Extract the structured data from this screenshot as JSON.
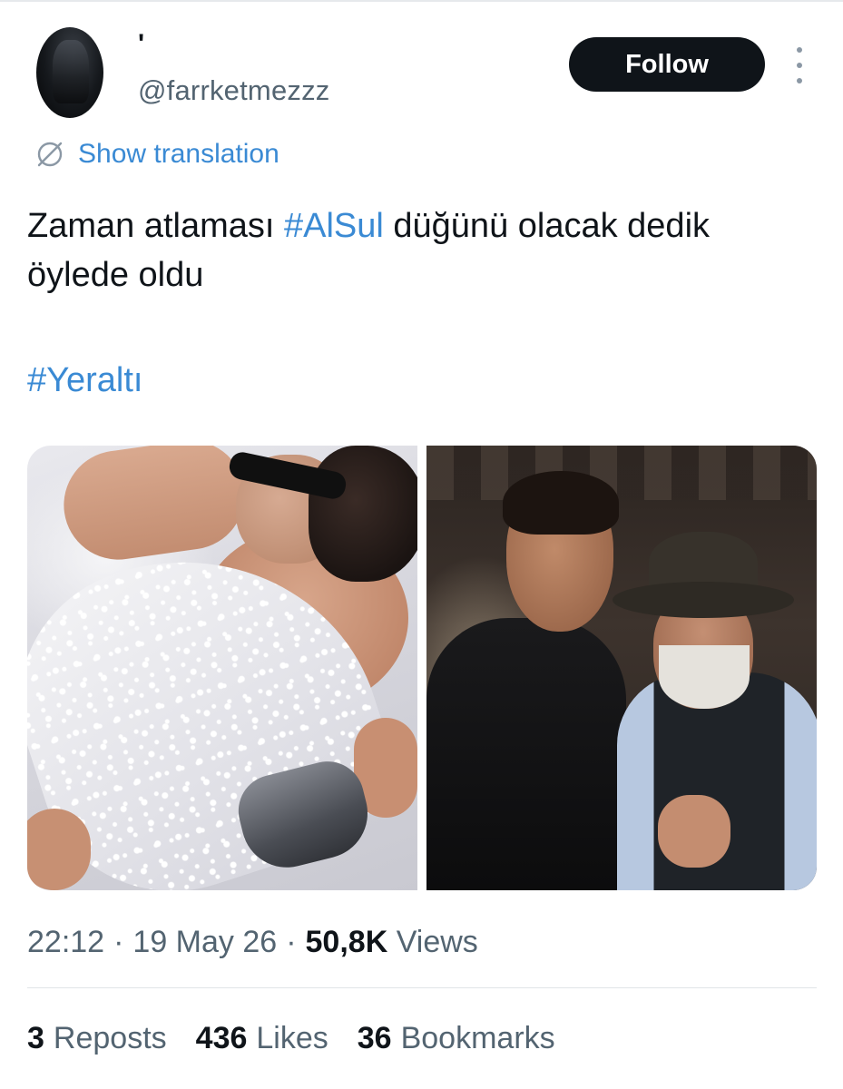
{
  "author": {
    "display_name": "'",
    "handle": "@farrketmezzz"
  },
  "follow_label": "Follow",
  "translation_label": "Show translation",
  "tweet": {
    "line_prefix": "Zaman atlaması ",
    "hashtag1": "#AlSul",
    "line_suffix": " düğünü olacak dedik öylede oldu",
    "hashtag2": "#Yeraltı"
  },
  "meta": {
    "time": "22:12",
    "sep1": "·",
    "date": "19 May 26",
    "sep2": "·",
    "views_count": "50,8K",
    "views_label": "Views"
  },
  "stats": {
    "reposts_count": "3",
    "reposts_label": "Reposts",
    "likes_count": "436",
    "likes_label": "Likes",
    "bookmarks_count": "36",
    "bookmarks_label": "Bookmarks"
  },
  "colors": {
    "link": "#3a8ad4",
    "follow_bg": "#0f1419",
    "muted": "#536471"
  }
}
